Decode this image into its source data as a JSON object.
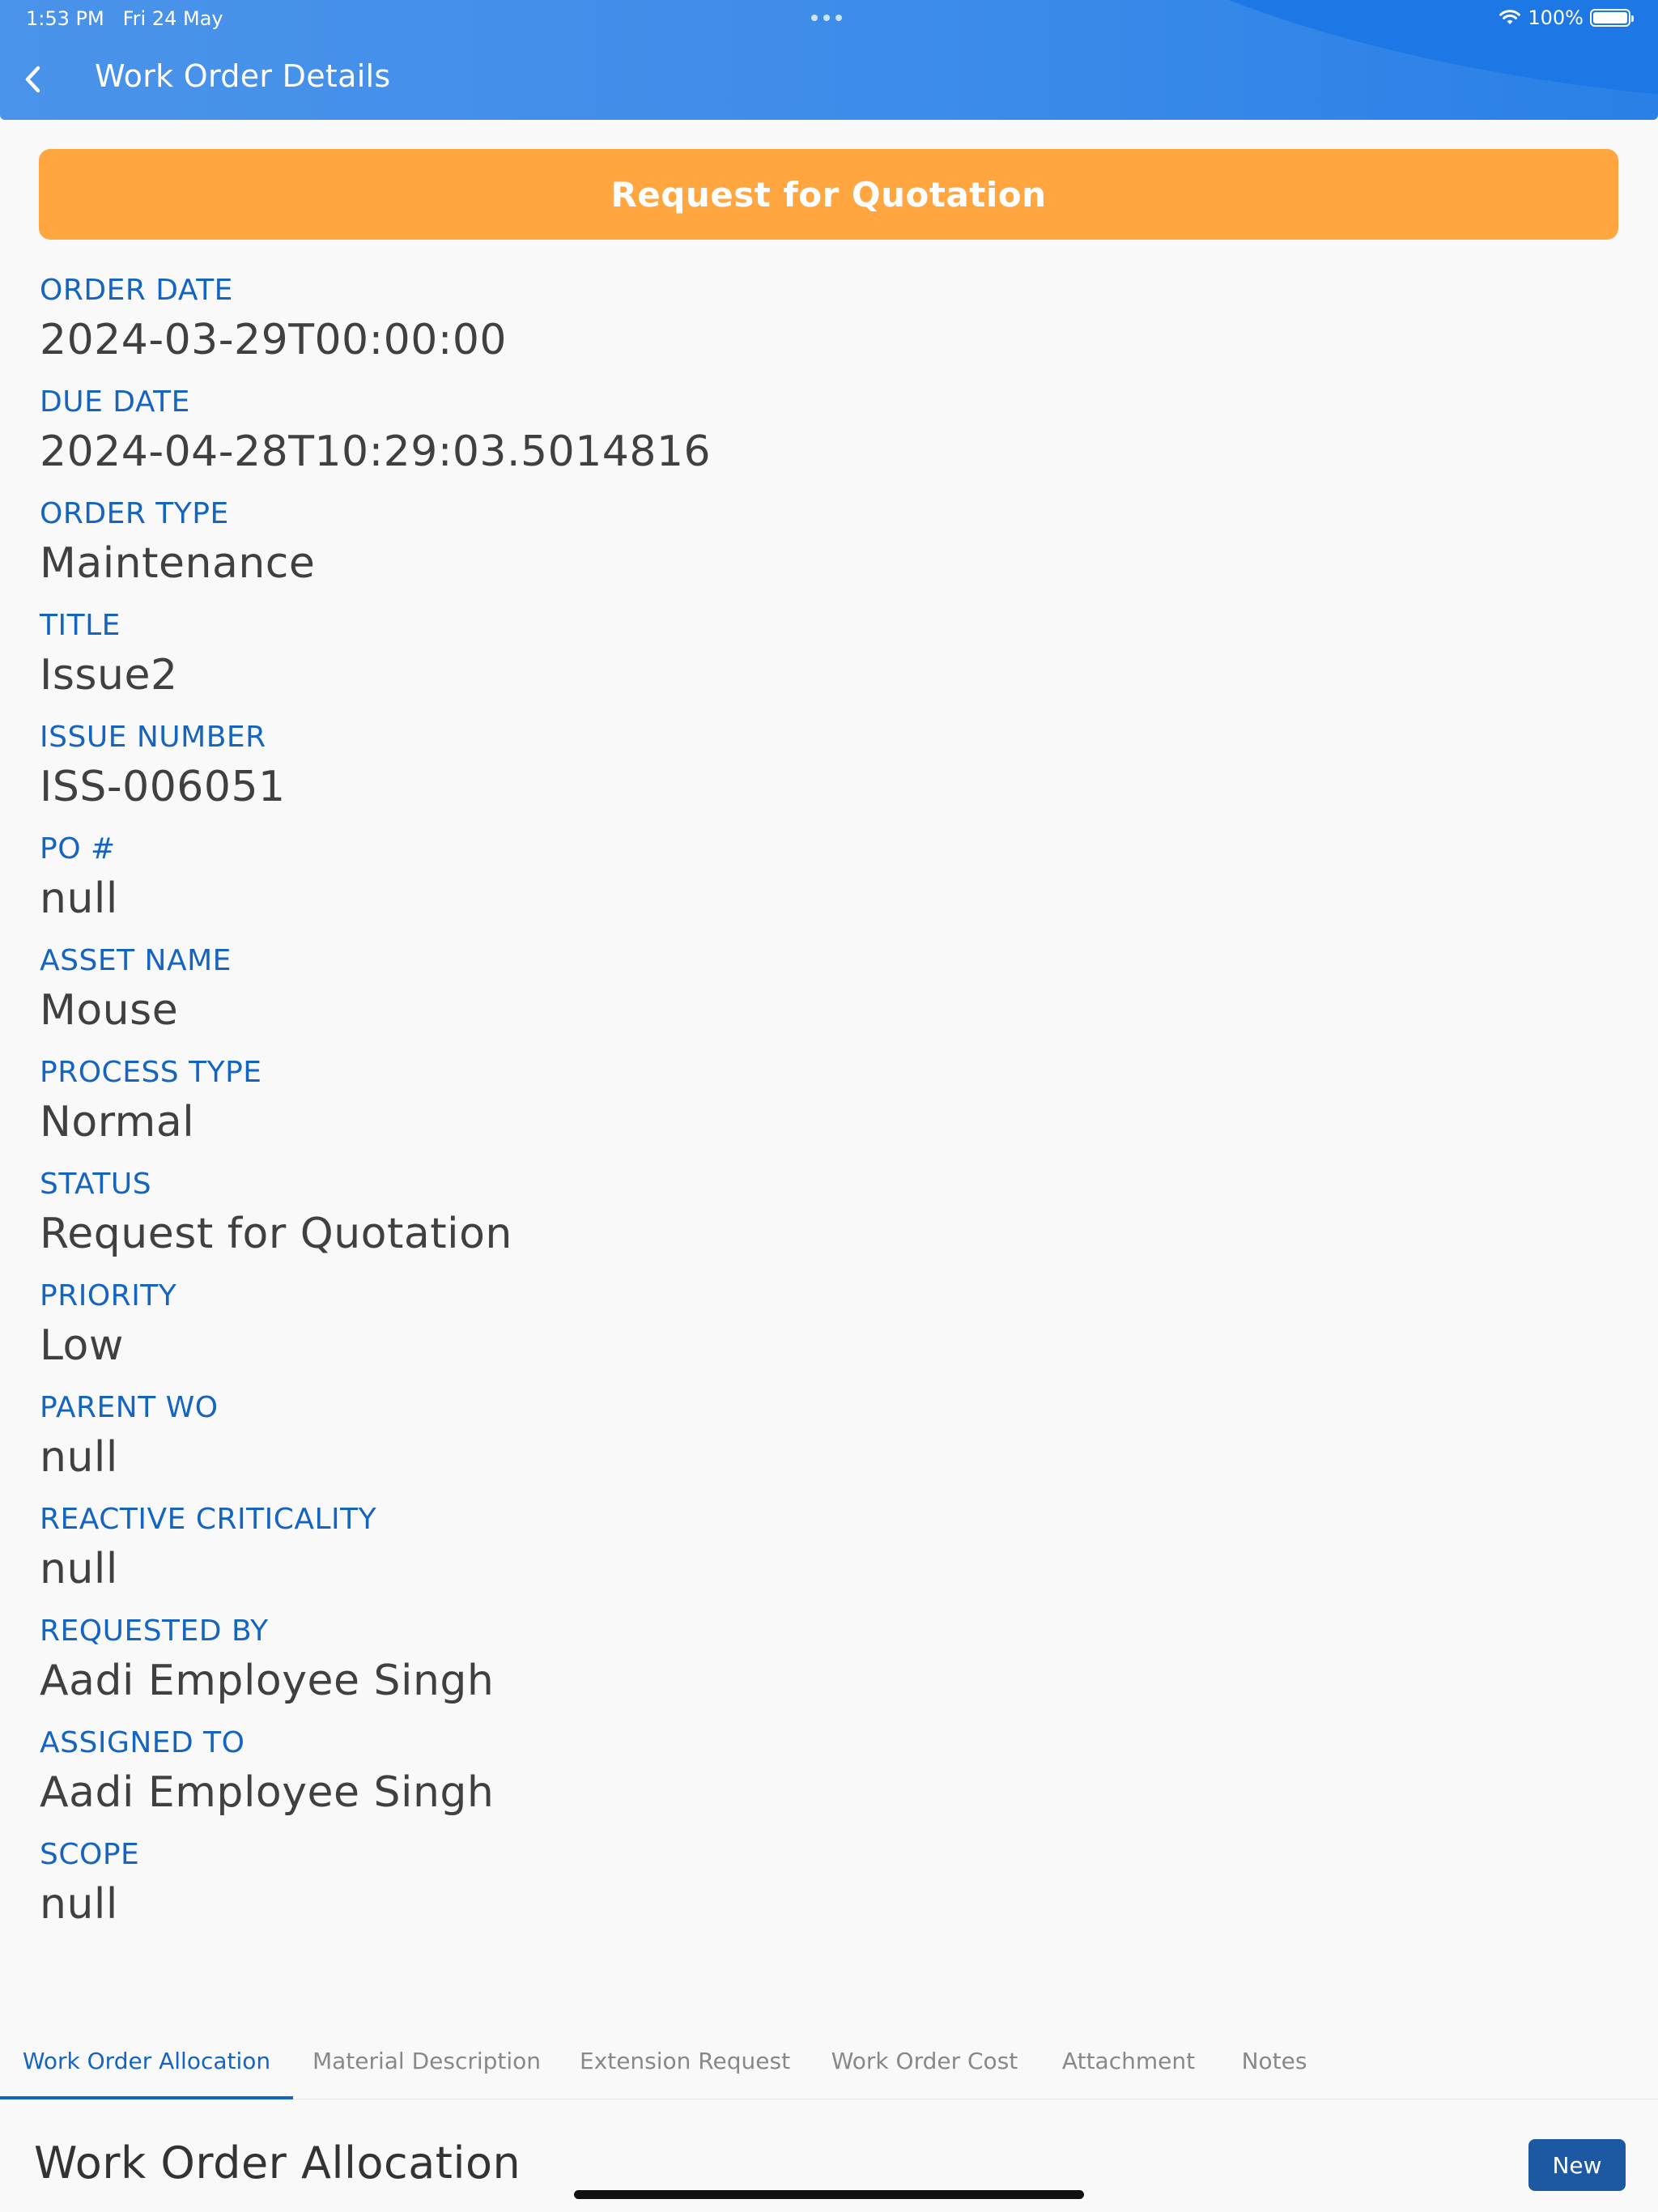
{
  "status_bar": {
    "time": "1:53 PM",
    "date": "Fri 24 May",
    "battery": "100%"
  },
  "header": {
    "title": "Work Order Details",
    "back_icon": "chevron-left-icon"
  },
  "banner": {
    "label": "Request for Quotation",
    "color": "#ffa640"
  },
  "fields": [
    {
      "label": "ORDER DATE",
      "value": "2024-03-29T00:00:00"
    },
    {
      "label": "DUE DATE",
      "value": "2024-04-28T10:29:03.5014816"
    },
    {
      "label": "ORDER TYPE",
      "value": "Maintenance"
    },
    {
      "label": "TITLE",
      "value": "Issue2"
    },
    {
      "label": "ISSUE NUMBER",
      "value": "ISS-006051"
    },
    {
      "label": "PO #",
      "value": "null"
    },
    {
      "label": "ASSET NAME",
      "value": "Mouse"
    },
    {
      "label": "PROCESS TYPE",
      "value": "Normal"
    },
    {
      "label": "STATUS",
      "value": "Request for Quotation"
    },
    {
      "label": "PRIORITY",
      "value": "Low"
    },
    {
      "label": "PARENT WO",
      "value": "null"
    },
    {
      "label": "REACTIVE CRITICALITY",
      "value": "null"
    },
    {
      "label": "REQUESTED BY",
      "value": "Aadi Employee Singh"
    },
    {
      "label": "ASSIGNED TO",
      "value": "Aadi Employee Singh"
    },
    {
      "label": "SCOPE",
      "value": "null"
    }
  ],
  "tabs": [
    {
      "label": "Work Order Allocation",
      "active": true
    },
    {
      "label": "Material Description",
      "active": false
    },
    {
      "label": "Extension Request",
      "active": false
    },
    {
      "label": "Work Order Cost",
      "active": false
    },
    {
      "label": "Attachment",
      "active": false
    },
    {
      "label": "Notes",
      "active": false
    }
  ],
  "section": {
    "title": "Work Order Allocation",
    "new_button": "New"
  },
  "colors": {
    "header_blue": "#3d8ce9",
    "label_blue": "#1565c0",
    "banner_orange": "#ffa640",
    "button_blue": "#1d59a3"
  }
}
